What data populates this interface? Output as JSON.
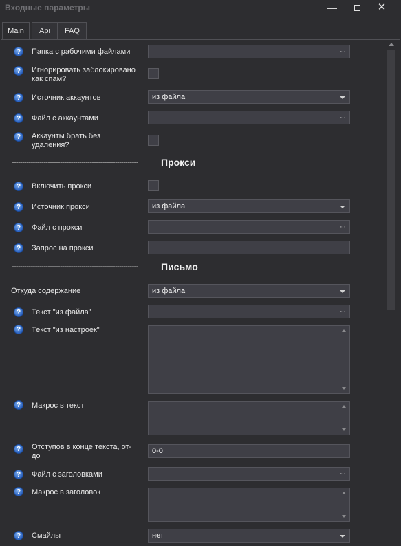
{
  "window": {
    "title": "Входные параметры",
    "minimize": "—",
    "close": "✕"
  },
  "tabs": [
    {
      "label": "Main",
      "active": true
    },
    {
      "label": "Api",
      "active": false
    },
    {
      "label": "FAQ",
      "active": false
    }
  ],
  "help_glyph": "?",
  "browse_glyph": "···",
  "fields": {
    "work_folder": {
      "label": "Папка с рабочими файлами",
      "value": ""
    },
    "ignore_spam": {
      "label": "Игнорировать заблокировано как спам?",
      "checked": false
    },
    "accounts_source": {
      "label": "Источник аккаунтов",
      "value": "из файла"
    },
    "accounts_file": {
      "label": "Файл с аккаунтами",
      "value": ""
    },
    "accounts_no_delete": {
      "label": "Аккаунты брать без удаления?",
      "checked": false
    },
    "proxy_enable": {
      "label": "Включить прокси",
      "checked": false
    },
    "proxy_source": {
      "label": "Источник прокси",
      "value": "из файла"
    },
    "proxy_file": {
      "label": "Файл с прокси",
      "value": ""
    },
    "proxy_request": {
      "label": "Запрос на прокси",
      "value": ""
    },
    "content_source": {
      "label": "Откуда содержание",
      "value": "из файла"
    },
    "text_from_file": {
      "label": "Текст \"из файла\"",
      "value": ""
    },
    "text_from_settings": {
      "label": "Текст \"из настроек\"",
      "value": ""
    },
    "text_macro": {
      "label": "Макрос в текст",
      "value": ""
    },
    "end_indents": {
      "label": "Отступов в конце текста, от-до",
      "value": "0-0"
    },
    "subjects_file": {
      "label": "Файл с заголовками",
      "value": ""
    },
    "subject_macro": {
      "label": "Макрос в заголовок",
      "value": ""
    },
    "smileys": {
      "label": "Смайлы",
      "value": "нет"
    }
  },
  "sections": {
    "line": "------------------------------------------------------------",
    "proxy": "Прокси",
    "letter": "Письмо"
  }
}
